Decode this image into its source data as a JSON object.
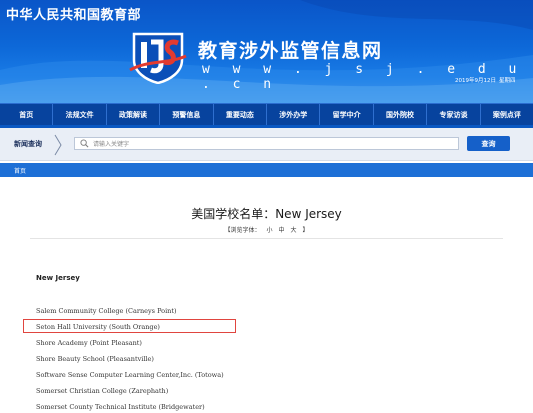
{
  "header": {
    "gov_title": "中华人民共和国教育部",
    "site_name": "教育涉外监管信息网",
    "site_url": "w w w . j s j . e d u . c n",
    "date": "2019年9月12日",
    "weekday": "星期四"
  },
  "nav": {
    "items": [
      "首页",
      "法规文件",
      "政策解读",
      "预警信息",
      "重要动态",
      "涉外办学",
      "留学中介",
      "国外院校",
      "专家访谈",
      "案例点评"
    ]
  },
  "search": {
    "label": "新闻查询",
    "placeholder": "请输入关键字",
    "button_label": "查询"
  },
  "breadcrumb": {
    "home": "首页"
  },
  "article": {
    "title": "美国学校名单：New Jersey",
    "font_size_prefix": "【浏览字体：",
    "font_small": "小",
    "font_medium": "中",
    "font_large": "大",
    "font_size_suffix": "】",
    "section_heading": "New Jersey",
    "schools": [
      "Salem Community College (Carneys Point)",
      "Seton Hall University (South Orange)",
      "Shore Academy (Point Pleasant)",
      "Shore Beauty School (Pleasantville)",
      "Software Sense Computer Learning Center,Inc. (Totowa)",
      "Somerset Christian College (Zarephath)",
      "Somerset County Technical Institute (Bridgewater)"
    ]
  },
  "colors": {
    "banner_blue": "#0d68d8",
    "nav_blue": "#07439e",
    "highlight_red": "#e0453f"
  }
}
